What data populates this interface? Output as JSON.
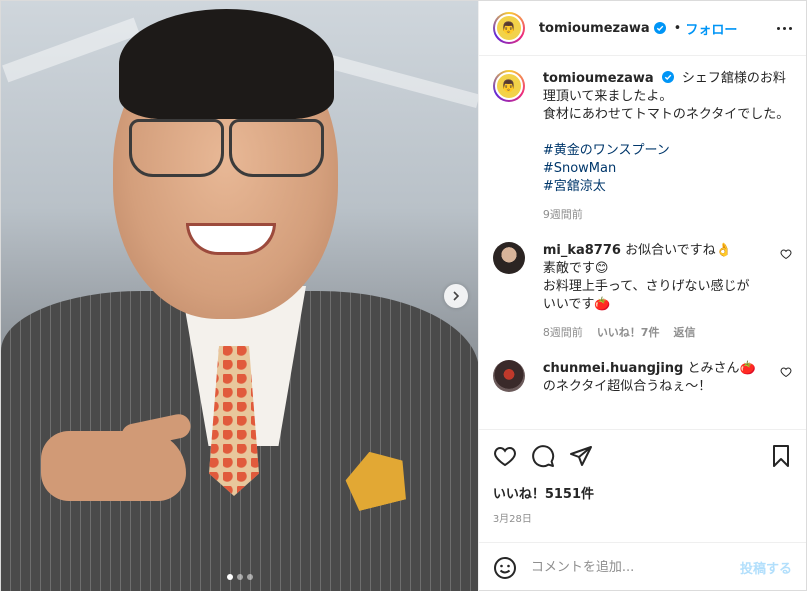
{
  "author": {
    "username": "tomioumezawa",
    "follow_label": "フォロー",
    "separator": "•"
  },
  "caption": {
    "text": "シェフ舘様のお料理頂いて来ましたよ。\n食材にあわせてトマトのネクタイでした。",
    "hashtags": [
      "#黄金のワンスプーン",
      "#SnowMan",
      "#宮舘涼太"
    ],
    "time": "9週間前"
  },
  "comments": [
    {
      "username": "mi_ka8776",
      "text": "お似合いですね👌\n素敵です😊\nお料理上手って、さりげない感じがいいです🍅",
      "time": "8週間前",
      "likes": "いいね！7件",
      "reply_label": "返信"
    },
    {
      "username": "chunmei.huangjing",
      "text": "とみさん🍅のネクタイ超似合うねぇ〜！",
      "time": "",
      "likes": "",
      "reply_label": ""
    }
  ],
  "footer": {
    "likes": "いいね！5151件",
    "date": "3月28日",
    "comment_placeholder": "コメントを追加...",
    "post_label": "投稿する"
  },
  "carousel": {
    "current": 1,
    "total": 3
  },
  "colors": {
    "accent": "#0095f6",
    "hashtag": "#00376b",
    "muted": "#8e8e8e"
  }
}
